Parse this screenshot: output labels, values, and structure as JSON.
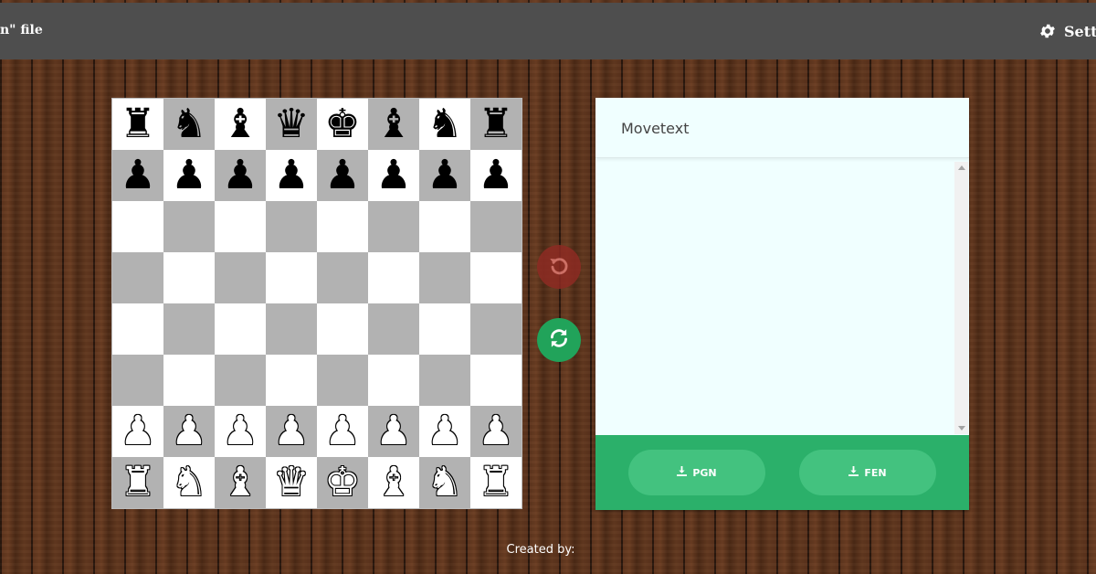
{
  "topbar": {
    "left_text": "n\" file",
    "settings_label": "Sett",
    "settings_icon": "gear-icon"
  },
  "board": {
    "light_color": "#ffffff",
    "dark_color": "#b2b2b2",
    "rows": [
      [
        {
          "g": "♜",
          "c": "b"
        },
        {
          "g": "♞",
          "c": "b"
        },
        {
          "g": "♝",
          "c": "b"
        },
        {
          "g": "♛",
          "c": "b"
        },
        {
          "g": "♚",
          "c": "b"
        },
        {
          "g": "♝",
          "c": "b"
        },
        {
          "g": "♞",
          "c": "b"
        },
        {
          "g": "♜",
          "c": "b"
        }
      ],
      [
        {
          "g": "♟",
          "c": "b"
        },
        {
          "g": "♟",
          "c": "b"
        },
        {
          "g": "♟",
          "c": "b"
        },
        {
          "g": "♟",
          "c": "b"
        },
        {
          "g": "♟",
          "c": "b"
        },
        {
          "g": "♟",
          "c": "b"
        },
        {
          "g": "♟",
          "c": "b"
        },
        {
          "g": "♟",
          "c": "b"
        }
      ],
      [
        null,
        null,
        null,
        null,
        null,
        null,
        null,
        null
      ],
      [
        null,
        null,
        null,
        null,
        null,
        null,
        null,
        null
      ],
      [
        null,
        null,
        null,
        null,
        null,
        null,
        null,
        null
      ],
      [
        null,
        null,
        null,
        null,
        null,
        null,
        null,
        null
      ],
      [
        {
          "g": "♟",
          "c": "w"
        },
        {
          "g": "♟",
          "c": "w"
        },
        {
          "g": "♟",
          "c": "w"
        },
        {
          "g": "♟",
          "c": "w"
        },
        {
          "g": "♟",
          "c": "w"
        },
        {
          "g": "♟",
          "c": "w"
        },
        {
          "g": "♟",
          "c": "w"
        },
        {
          "g": "♟",
          "c": "w"
        }
      ],
      [
        {
          "g": "♜",
          "c": "w"
        },
        {
          "g": "♞",
          "c": "w"
        },
        {
          "g": "♝",
          "c": "w"
        },
        {
          "g": "♛",
          "c": "w"
        },
        {
          "g": "♚",
          "c": "w"
        },
        {
          "g": "♝",
          "c": "w"
        },
        {
          "g": "♞",
          "c": "w"
        },
        {
          "g": "♜",
          "c": "w"
        }
      ]
    ]
  },
  "controls": {
    "undo_icon": "undo-icon",
    "flip_icon": "flip-board-icon",
    "undo_color": "#8e2b23",
    "flip_color": "#21a35a"
  },
  "panel": {
    "title": "Movetext",
    "movetext": "",
    "pgn_label": "PGN",
    "fen_label": "FEN",
    "download_icon": "download-icon",
    "footer_color": "#2bb06a"
  },
  "footer": {
    "created_by": "Created by:"
  }
}
